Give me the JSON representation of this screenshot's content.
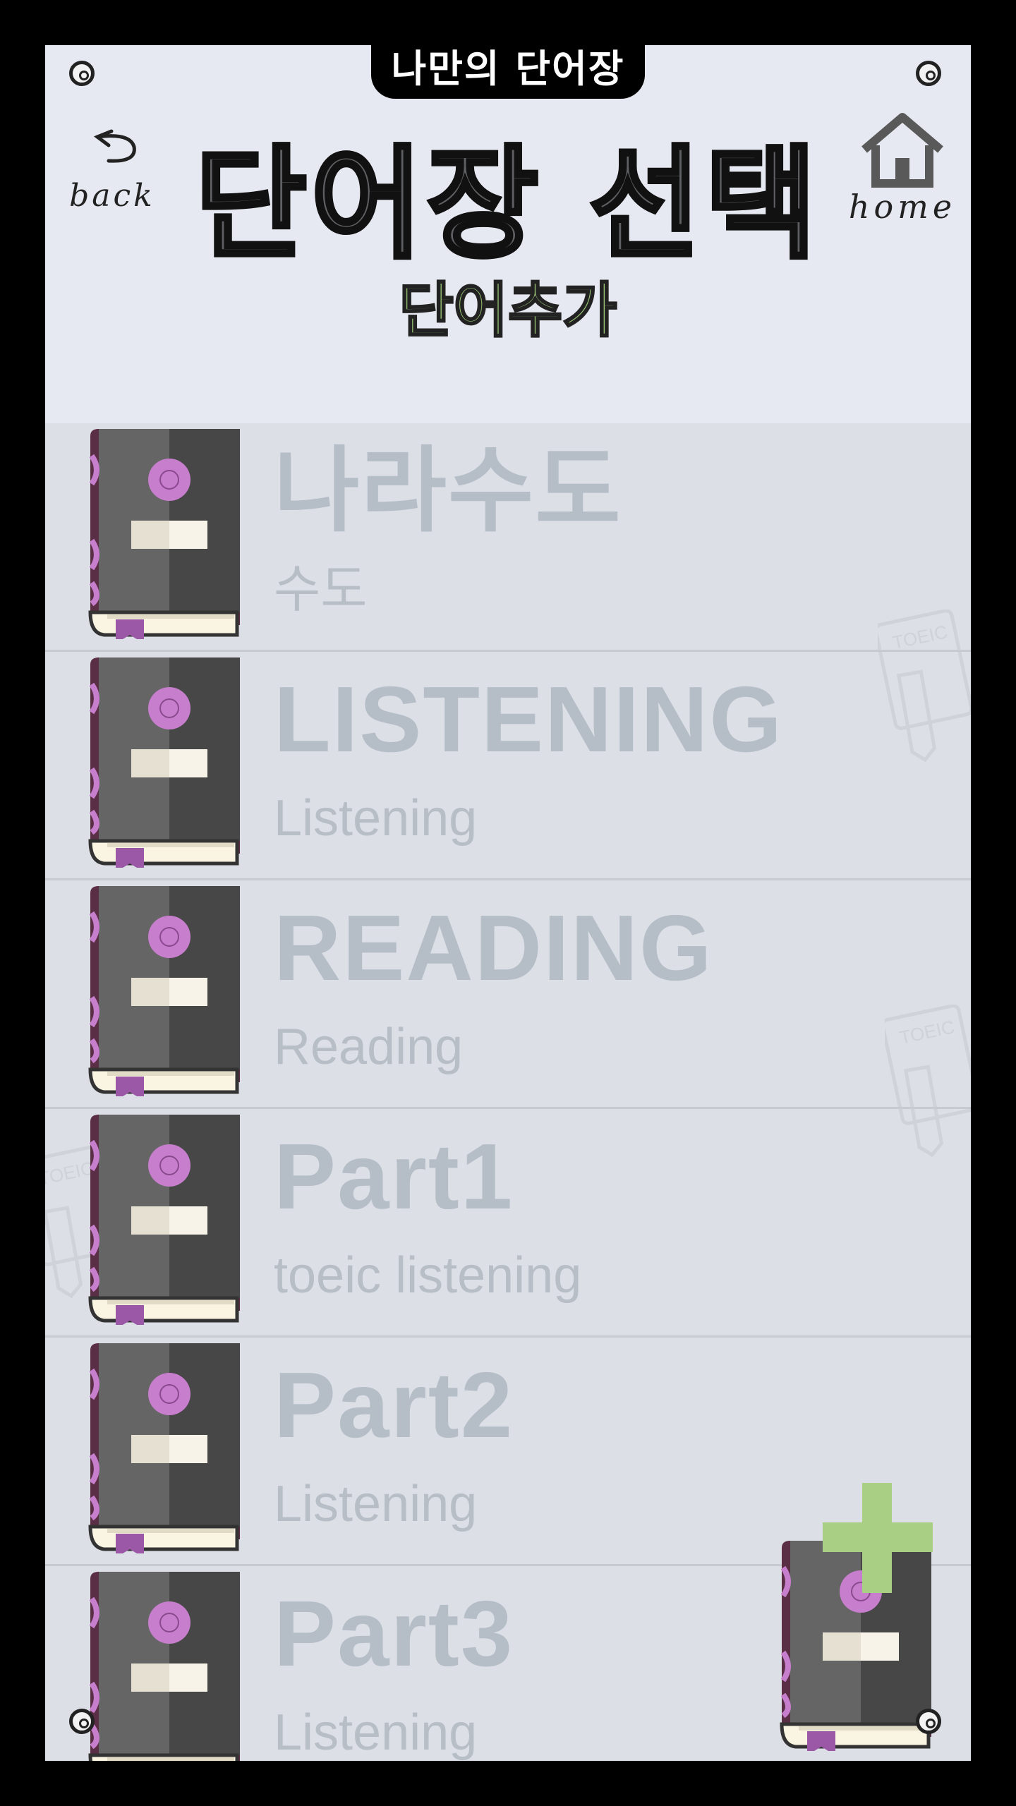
{
  "app_tab": "나만의 단어장",
  "back_label": "back",
  "home_label": "home",
  "page_title": "단어장 선택",
  "add_word_label": "단어추가",
  "wordbooks": [
    {
      "title": "나라수도",
      "subtitle": "수도"
    },
    {
      "title": "LISTENING",
      "subtitle": "Listening"
    },
    {
      "title": "READING",
      "subtitle": "Reading"
    },
    {
      "title": "Part1",
      "subtitle": "toeic listening"
    },
    {
      "title": "Part2",
      "subtitle": "Listening"
    },
    {
      "title": "Part3",
      "subtitle": "Listening"
    }
  ],
  "icons": {
    "back": "back-arrow-icon",
    "home": "home-icon",
    "book": "book-icon",
    "add_book": "add-book-icon",
    "decor": "toeic-notebook-icon"
  },
  "colors": {
    "accent_green": "#9ac774",
    "book_purple": "#c77ecc",
    "header_bg": "#e6e9f1",
    "list_bg": "#dcdfe6"
  }
}
